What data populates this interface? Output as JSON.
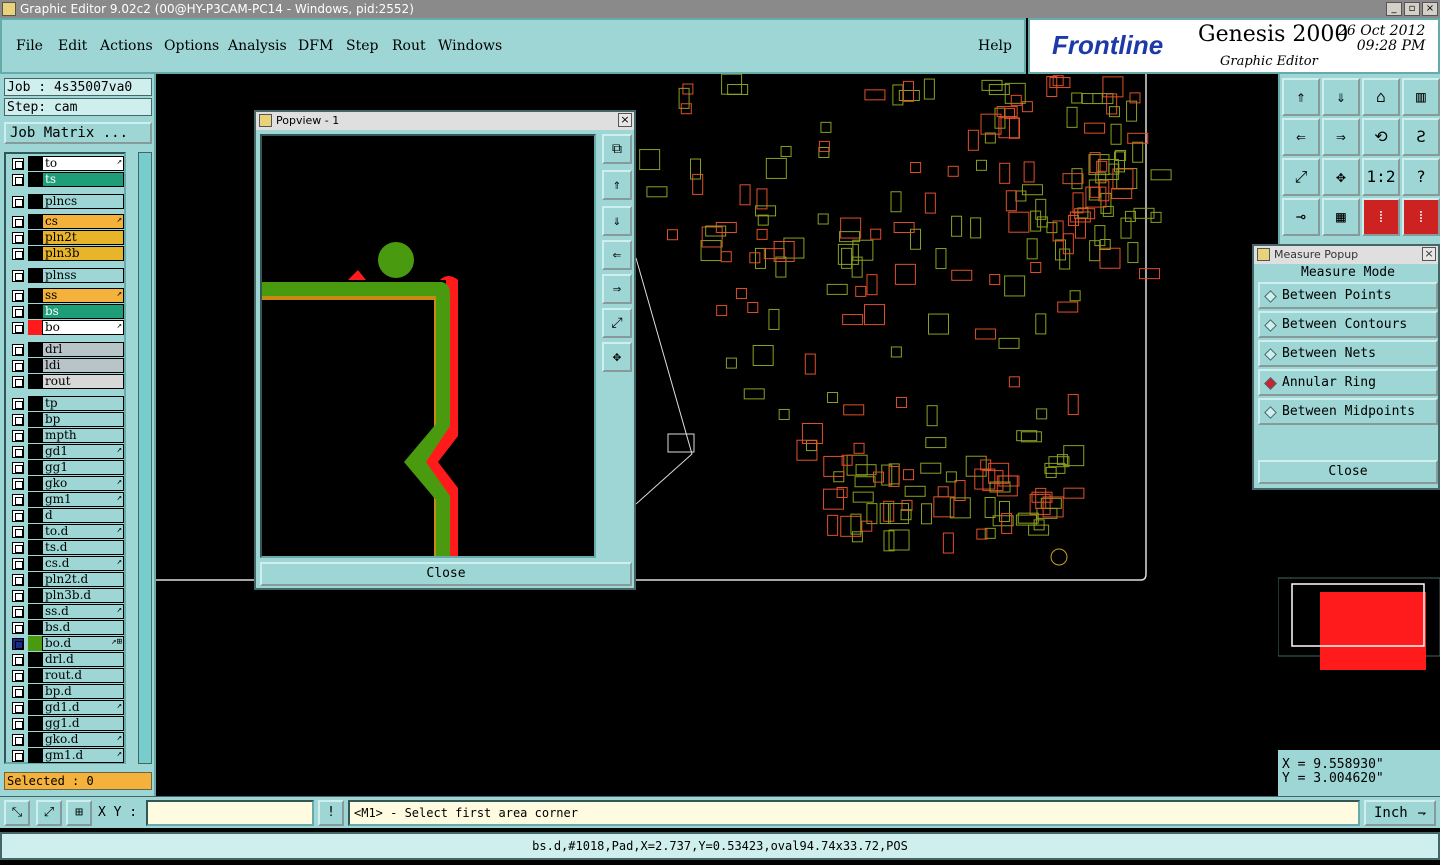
{
  "window": {
    "title": "Graphic Editor 9.02c2 (00@HY-P3CAM-PC14 - Windows, pid:2552)"
  },
  "menu": {
    "items": [
      {
        "label": "File"
      },
      {
        "label": "Edit"
      },
      {
        "label": "Actions"
      },
      {
        "label": "Options"
      },
      {
        "label": "Analysis"
      },
      {
        "label": "DFM"
      },
      {
        "label": "Step"
      },
      {
        "label": "Rout"
      },
      {
        "label": "Windows"
      }
    ],
    "help": "Help"
  },
  "brand": {
    "logo": "Frontline",
    "product": "Genesis 2000",
    "subtitle": "Graphic Editor",
    "date": "26 Oct 2012",
    "time": "09:28 PM"
  },
  "job": {
    "label": "Job : 4s35007va0",
    "step": "Step: cam",
    "matrix_button": "Job Matrix ..."
  },
  "layers": [
    {
      "name": "to",
      "color": "#ffffff",
      "swatch": "#000000",
      "mark": "↗"
    },
    {
      "name": "ts",
      "color": "#1d9e78",
      "swatch": "#000000",
      "mark": ""
    },
    {
      "name": "plncs",
      "color": "#9dd6d4",
      "swatch": "#000000",
      "mark": ""
    },
    {
      "name": "cs",
      "color": "#f4b23c",
      "swatch": "#000000",
      "mark": "↗"
    },
    {
      "name": "pln2t",
      "color": "#e8b42a",
      "swatch": "#000000",
      "mark": ""
    },
    {
      "name": "pln3b",
      "color": "#e8b42a",
      "swatch": "#000000",
      "mark": ""
    },
    {
      "name": "plnss",
      "color": "#9dd6d4",
      "swatch": "#000000",
      "mark": ""
    },
    {
      "name": "ss",
      "color": "#f4b23c",
      "swatch": "#000000",
      "mark": "↗"
    },
    {
      "name": "bs",
      "color": "#1d9e78",
      "swatch": "#000000",
      "mark": ""
    },
    {
      "name": "bo",
      "color": "#ffffff",
      "swatch": "#ff1b1b",
      "mark": "↗"
    },
    {
      "name": "drl",
      "color": "#b8c4c8",
      "swatch": "#000000",
      "mark": ""
    },
    {
      "name": "ldi",
      "color": "#b8c4c8",
      "swatch": "#000000",
      "mark": ""
    },
    {
      "name": "rout",
      "color": "#d8d8d8",
      "swatch": "#000000",
      "mark": ""
    },
    {
      "name": "tp",
      "color": "#9dd6d4",
      "swatch": "#000000",
      "mark": ""
    },
    {
      "name": "bp",
      "color": "#9dd6d4",
      "swatch": "#000000",
      "mark": ""
    },
    {
      "name": "mpth",
      "color": "#9dd6d4",
      "swatch": "#000000",
      "mark": ""
    },
    {
      "name": "gd1",
      "color": "#9dd6d4",
      "swatch": "#000000",
      "mark": "↗"
    },
    {
      "name": "gg1",
      "color": "#9dd6d4",
      "swatch": "#000000",
      "mark": ""
    },
    {
      "name": "gko",
      "color": "#9dd6d4",
      "swatch": "#000000",
      "mark": "↗"
    },
    {
      "name": "gm1",
      "color": "#9dd6d4",
      "swatch": "#000000",
      "mark": "↗"
    },
    {
      "name": "d",
      "color": "#9dd6d4",
      "swatch": "#000000",
      "mark": ""
    },
    {
      "name": "to.d",
      "color": "#9dd6d4",
      "swatch": "#000000",
      "mark": "↗"
    },
    {
      "name": "ts.d",
      "color": "#9dd6d4",
      "swatch": "#000000",
      "mark": ""
    },
    {
      "name": "cs.d",
      "color": "#9dd6d4",
      "swatch": "#000000",
      "mark": "↗"
    },
    {
      "name": "pln2t.d",
      "color": "#9dd6d4",
      "swatch": "#000000",
      "mark": ""
    },
    {
      "name": "pln3b.d",
      "color": "#9dd6d4",
      "swatch": "#000000",
      "mark": ""
    },
    {
      "name": "ss.d",
      "color": "#9dd6d4",
      "swatch": "#000000",
      "mark": "↗"
    },
    {
      "name": "bs.d",
      "color": "#9dd6d4",
      "swatch": "#000000",
      "mark": ""
    },
    {
      "name": "bo.d",
      "color": "#9dd6d4",
      "swatch": "#4a9a10",
      "mark": "↗⊞"
    },
    {
      "name": "drl.d",
      "color": "#9dd6d4",
      "swatch": "#000000",
      "mark": ""
    },
    {
      "name": "rout.d",
      "color": "#9dd6d4",
      "swatch": "#000000",
      "mark": ""
    },
    {
      "name": "bp.d",
      "color": "#9dd6d4",
      "swatch": "#000000",
      "mark": ""
    },
    {
      "name": "gd1.d",
      "color": "#9dd6d4",
      "swatch": "#000000",
      "mark": "↗"
    },
    {
      "name": "gg1.d",
      "color": "#9dd6d4",
      "swatch": "#000000",
      "mark": ""
    },
    {
      "name": "gko.d",
      "color": "#9dd6d4",
      "swatch": "#000000",
      "mark": "↗"
    },
    {
      "name": "gm1.d",
      "color": "#9dd6d4",
      "swatch": "#000000",
      "mark": "↗"
    }
  ],
  "selected": "Selected : 0",
  "popview": {
    "title": "Popview - 1",
    "close": "Close"
  },
  "measure": {
    "title": "Measure Popup",
    "mode_label": "Measure Mode",
    "options": [
      {
        "label": "Between Points",
        "selected": false
      },
      {
        "label": "Between Contours",
        "selected": false
      },
      {
        "label": "Between Nets",
        "selected": false
      },
      {
        "label": "Annular Ring",
        "selected": true
      },
      {
        "label": "Between Midpoints",
        "selected": false
      }
    ],
    "close": "Close"
  },
  "coords": {
    "x": "X = 9.558930\"",
    "y": "Y = 3.004620\""
  },
  "command": {
    "xy_label": "X Y :",
    "xy_value": "",
    "prompt": "<M1> - Select first area corner",
    "unit": "Inch"
  },
  "status": "bs.d,#1018,Pad,X=2.737,Y=0.53423,oval94.74x33.72,POS",
  "toolbar_icons": [
    "zoom-home-icon",
    "zoom-in-icon",
    "home-icon",
    "split-view-icon",
    "pan-left-icon",
    "pan-right-icon",
    "undo-icon",
    "s-curve-icon",
    "fit-screen-icon",
    "center-icon",
    "ratio-icon",
    "help-icon",
    "measure-icon",
    "grid-icon",
    "net-red-icon",
    "net-red-alt-icon"
  ],
  "toolbar_glyphs": [
    "⇑",
    "⇓",
    "⌂",
    "▥",
    "⇐",
    "⇒",
    "⟲",
    "Ƨ",
    "⤢",
    "✥",
    "1:2",
    "?",
    "⊸",
    "▦",
    "⁞",
    "⁞"
  ]
}
